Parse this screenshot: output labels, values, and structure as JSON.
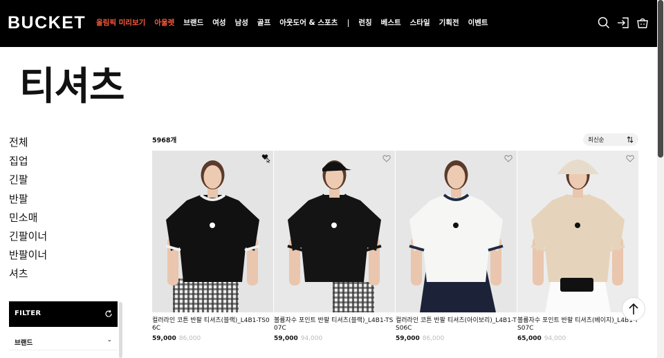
{
  "header": {
    "logo": "BUCKET",
    "nav_highlight": [
      {
        "label": "올림픽 미리보기"
      },
      {
        "label": "아울렛"
      }
    ],
    "nav": [
      {
        "label": "브랜드"
      },
      {
        "label": "여성"
      },
      {
        "label": "남성"
      },
      {
        "label": "골프"
      },
      {
        "label": "아웃도어 & 스포츠"
      }
    ],
    "nav_secondary": [
      {
        "label": "런칭"
      },
      {
        "label": "베스트"
      },
      {
        "label": "스타일"
      },
      {
        "label": "기획전"
      },
      {
        "label": "이벤트"
      }
    ],
    "accent_color": "#ff5a3c",
    "icons": [
      "search-icon",
      "login-icon",
      "cart-icon"
    ]
  },
  "page": {
    "title": "티셔츠"
  },
  "sidebar": {
    "categories": [
      {
        "label": "전체"
      },
      {
        "label": "집업"
      },
      {
        "label": "긴팔"
      },
      {
        "label": "반팔"
      },
      {
        "label": "민소매"
      },
      {
        "label": "긴팔이너"
      },
      {
        "label": "반팔이너"
      },
      {
        "label": "셔츠"
      }
    ],
    "filter_label": "FILTER",
    "brand_label": "브랜드"
  },
  "listing": {
    "count": "5968개",
    "sort_label": "최신순",
    "products": [
      {
        "name": "컬러라인 코튼 반팔 티셔츠(블랙)_L4B1-TS06C",
        "price": "59,000",
        "original_price": "86,000",
        "shirt_color": "#111111",
        "trim_color": "#f0f0f0",
        "bg": "#e4e4e4",
        "bottom": "plaid"
      },
      {
        "name": "볼륨자수 포인트 반팔 티셔츠(블랙)_L4B1-TS07C",
        "price": "59,000",
        "original_price": "94,000",
        "shirt_color": "#141414",
        "trim_color": "#141414",
        "bg": "#e8e8e8",
        "bottom": "check"
      },
      {
        "name": "컬러라인 코튼 반팔 티셔츠(아이보리)_L4B1-TS06C",
        "price": "59,000",
        "original_price": "86,000",
        "shirt_color": "#f6f6f4",
        "trim_color": "#1f2a44",
        "bg": "#e6e6e6",
        "bottom": "navy"
      },
      {
        "name": "볼륨자수 포인트 반팔 티셔츠(베이지)_L4B1-TS07C",
        "price": "65,000",
        "original_price": "94,000",
        "shirt_color": "#e6d3bb",
        "trim_color": "#e6d3bb",
        "bg": "#ececec",
        "bottom": "white"
      }
    ]
  }
}
